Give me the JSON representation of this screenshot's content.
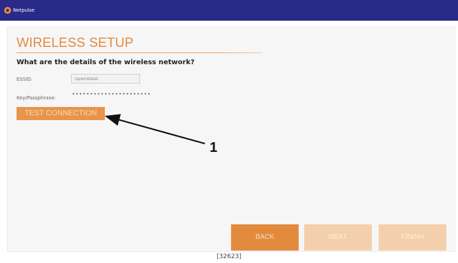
{
  "app": {
    "brand": "Netpulse"
  },
  "page": {
    "title": "WIRELESS SETUP",
    "question": "What are the details of the wireless network?"
  },
  "form": {
    "essid_label": "ESSID:",
    "essid_value": "npwireless",
    "passphrase_label": "Key/Passphrase:",
    "passphrase_value": "••••••••••••••••••••••",
    "test_button": "TEST CONNECTION"
  },
  "nav": {
    "back": "BACK",
    "next": "NEXT",
    "finish": "FINISH"
  },
  "annotation": {
    "callout_number": "1"
  },
  "footer": {
    "code": "[32623]"
  },
  "colors": {
    "topbar": "#2a2a8a",
    "accent": "#e28a3e",
    "disabled_button": "#f3cfac"
  }
}
